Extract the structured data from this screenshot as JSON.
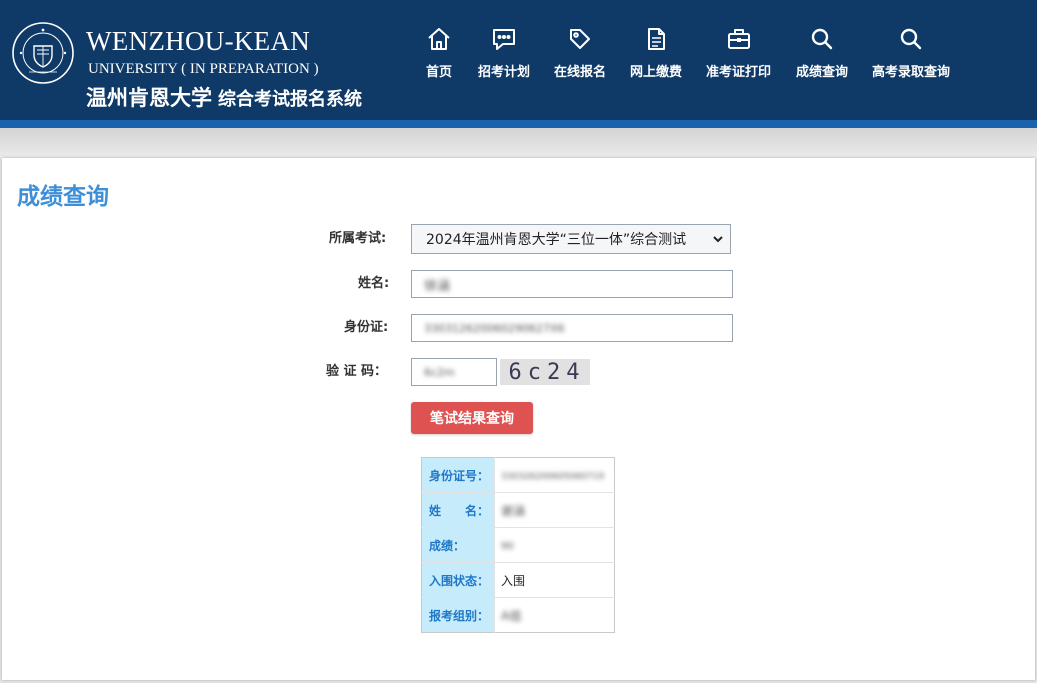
{
  "header": {
    "brand_en": "WENZHOU-KEAN",
    "brand_sub": "UNIVERSITY ( IN PREPARATION )",
    "brand_cn_uni": "温州肯恩大学",
    "brand_cn_system": "综合考试报名系统",
    "seal_text": "WENZHOU-KEAN · 1855",
    "colors": {
      "background": "#0f3a68",
      "stripe": "#1a62ad"
    }
  },
  "nav": [
    {
      "label": "首页",
      "icon": "home-icon"
    },
    {
      "label": "招考计划",
      "icon": "chat-icon"
    },
    {
      "label": "在线报名",
      "icon": "tag-icon"
    },
    {
      "label": "网上缴费",
      "icon": "document-icon"
    },
    {
      "label": "准考证打印",
      "icon": "briefcase-icon"
    },
    {
      "label": "成绩查询",
      "icon": "search-icon"
    },
    {
      "label": "高考录取查询",
      "icon": "search-icon"
    }
  ],
  "page": {
    "title": "成绩查询",
    "title_color": "#3d8fd8"
  },
  "form": {
    "exam_label": "所属考试:",
    "exam_selected": "2024年温州肯恩大学“三位一体”综合测试",
    "name_label": "姓名:",
    "name_value": "徐涵",
    "id_label": "身份证:",
    "id_value": "330312620060290627X6",
    "captcha_label": "验 证 码：",
    "captcha_value": "6c2m",
    "captcha_image_text": "6c24",
    "submit_label": "笔试结果查询",
    "submit_color": "#de5252"
  },
  "result": {
    "rows": [
      {
        "key": "身份证号：",
        "value": "330326200605060719"
      },
      {
        "key": "姓　　名：",
        "value": "谢涵"
      },
      {
        "key": "成绩：",
        "value": "90"
      },
      {
        "key": "入围状态：",
        "value": "入围"
      },
      {
        "key": "报考组别：",
        "value": "A组"
      }
    ],
    "key_background": "#c6ebfb",
    "key_color": "#1f78c8"
  }
}
